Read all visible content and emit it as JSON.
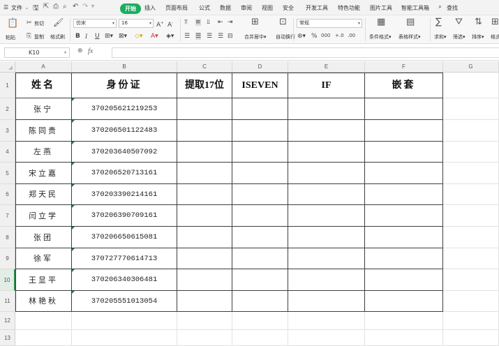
{
  "menubar": {
    "file_menu": "文件",
    "tabs": [
      "开始",
      "插入",
      "页面布局",
      "公式",
      "数据",
      "审阅",
      "视图",
      "安全",
      "开发工具",
      "特色功能",
      "图片工具",
      "智能工具箱"
    ],
    "search_label": "查找"
  },
  "ribbon": {
    "paste_label": "粘贴",
    "cut_label": "剪切",
    "copy_label": "复制",
    "format_painter_label": "格式刷",
    "font_name": "仿宋",
    "font_size": "16",
    "bold": "B",
    "italic": "I",
    "underline": "U",
    "merge_label": "合并居中",
    "wrap_label": "自动换行",
    "number_format": "常规",
    "cond_format_label": "条件格式",
    "table_style_label": "表格样式",
    "sum_label": "求和",
    "filter_label": "筛选",
    "sort_label": "排序",
    "format_label": "格式"
  },
  "formula_bar": {
    "name_box": "K10",
    "fx": "fx"
  },
  "columns": [
    "A",
    "B",
    "C",
    "D",
    "E",
    "F",
    "G"
  ],
  "row_numbers": [
    "1",
    "2",
    "3",
    "4",
    "5",
    "6",
    "7",
    "8",
    "9",
    "10",
    "11",
    "12",
    "13"
  ],
  "active_row": "10",
  "table": {
    "headers": [
      "姓名",
      "身份证",
      "提取17位",
      "ISEVEN",
      "IF",
      "嵌套"
    ],
    "rows": [
      [
        "张宁",
        "370205621219253"
      ],
      [
        "陈同贵",
        "370206501122483"
      ],
      [
        "左燕",
        "370203640507092"
      ],
      [
        "宋立嘉",
        "370206520713161"
      ],
      [
        "郑天民",
        "370203390214161"
      ],
      [
        "闫立学",
        "370206390709161"
      ],
      [
        "张团",
        "370206650615081"
      ],
      [
        "徐军",
        "370727770614713"
      ],
      [
        "王显平",
        "370206340306481"
      ],
      [
        "林艳秋",
        "370205551013054"
      ]
    ]
  },
  "colors": {
    "accent": "#1aad5e",
    "active_row": "#2f8a4d",
    "border": "#3d3d3d"
  }
}
